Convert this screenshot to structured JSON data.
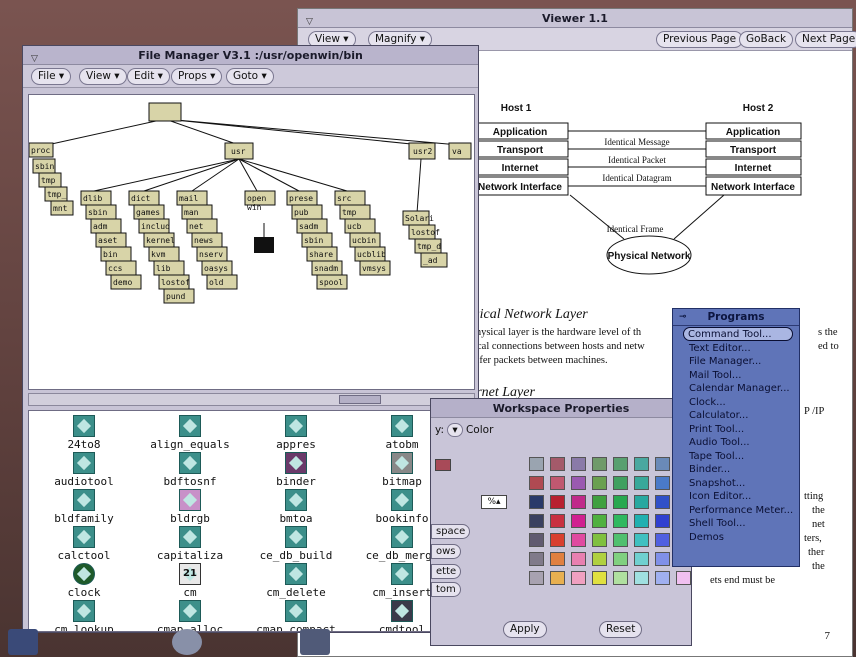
{
  "viewer": {
    "title": "Viewer 1.1",
    "menu": {
      "view": "View",
      "magnify": "Magnify"
    },
    "buttons": {
      "prev": "Previous Page",
      "back": "GoBack",
      "next": "Next Page"
    },
    "diagram": {
      "host1": "Host 1",
      "host2": "Host 2",
      "left_layers": [
        "Application",
        "Transport",
        "Internet",
        "Network Interface"
      ],
      "right_layers": [
        "Application",
        "Transport",
        "Internet",
        "Network Interface"
      ],
      "links": [
        "Identical Message",
        "Identical Packet",
        "Identical Datagram"
      ],
      "frame": "Identical Frame",
      "network": "Physical Network"
    },
    "doc": {
      "heading1": "ysical Network Layer",
      "para1_line1": "Physical layer is the hardware level of th",
      "para1_line2": "sical connections between hosts and netw",
      "para1_line3": "nsfer packets between machines.",
      "heading2": "ernet Layer",
      "frag_a": "s the",
      "frag_b": "ed to",
      "frag_c": "P /IP",
      "frag_d1": "tting",
      "frag_d2": "the",
      "frag_d3": "net",
      "frag_d4": "ters,",
      "frag_d5": "ther",
      "frag_d6": "the",
      "frag_d7": "ets end must be",
      "page": "7"
    }
  },
  "filemanager": {
    "title": "File Manager V3.1  :/usr/openwin/bin",
    "menu": [
      "File",
      "View",
      "Edit",
      "Props",
      "Goto"
    ],
    "tree": {
      "row1": [
        "proc",
        "usr",
        "usr2",
        "va"
      ],
      "proc_children": [
        "sbin",
        "tmp",
        "tmp_",
        "mnt"
      ],
      "usr_columns": [
        [
          "dlib",
          "sbin",
          "adm",
          "aset",
          "bin",
          "ccs",
          "demo"
        ],
        [
          "dict",
          "games",
          "includ",
          "kernel",
          "kvm",
          "lib",
          "lostof",
          "pund"
        ],
        [
          "mail",
          "man",
          "net",
          "news",
          "nserv",
          "oasys",
          "old"
        ],
        [
          "open",
          "win"
        ],
        [
          "prese",
          "pub",
          "sadm",
          "sbin",
          "share",
          "snadm",
          "spool"
        ],
        [
          "src",
          "tmp",
          "ucb",
          "ucbin",
          "ucblib",
          "vmsys"
        ]
      ],
      "usr2_children": [
        "Solari",
        "lostof",
        "tmp_d",
        "_ad"
      ]
    },
    "files": [
      "24to8",
      "align_equals",
      "appres",
      "atobm",
      "audiotool",
      "bdftosnf",
      "binder",
      "bitmap",
      "bldfamily",
      "bldrgb",
      "bmtoa",
      "bookinfo",
      "calctool",
      "capitaliza",
      "ce_db_build",
      "ce_db_merge",
      "clock",
      "cm",
      "cm_delete",
      "cm_insert",
      "cm_lookup",
      "cmap_alloc",
      "cmap_compact",
      "cmdtool"
    ],
    "calendar_icon_text": "21"
  },
  "workspace": {
    "title": "Workspace Properties",
    "category_label": "y:",
    "category_value": "Color",
    "side_buttons": [
      "space",
      "ows",
      "ette",
      "tom"
    ],
    "apply": "Apply",
    "reset": "Reset",
    "swatch_colors": [
      [
        "#9aa4b0",
        "#a45a6a",
        "#8a7aa8",
        "#6f9a6a",
        "#58a070",
        "#4aa8a0",
        "#6a8ab8",
        "#7ab0c8"
      ],
      [
        "#b04a52",
        "#c05870",
        "#9a5ab0",
        "#6aa050",
        "#40a060",
        "#38a89a",
        "#4a7ac8",
        "#70a0d8"
      ],
      [
        "#2a3a6a",
        "#b82030",
        "#c02a8a",
        "#40a040",
        "#28a850",
        "#28a8a0",
        "#3050c8",
        "#b86ab0"
      ],
      [
        "#3a4060",
        "#c83040",
        "#d02090",
        "#50b040",
        "#30b860",
        "#20b0b0",
        "#3040d0",
        "#c070c0"
      ],
      [
        "#605a70",
        "#d84030",
        "#e04aa0",
        "#80c040",
        "#50c070",
        "#40c0c0",
        "#5060e0",
        "#d090d0"
      ],
      [
        "#807a8a",
        "#e08040",
        "#e880b0",
        "#b0d040",
        "#80d080",
        "#70d0d0",
        "#8090e8",
        "#e0a0e0"
      ],
      [
        "#a8a2b0",
        "#e8b050",
        "#f0a0c0",
        "#e0e040",
        "#b0e0a0",
        "#a0e0e0",
        "#a0b0f0",
        "#f0c0f0"
      ]
    ]
  },
  "programs": {
    "title": "Programs",
    "items": [
      "Command Tool...",
      "Text Editor...",
      "File Manager...",
      "Mail Tool...",
      "Calendar Manager...",
      "Clock...",
      "Calculator...",
      "Print Tool...",
      "Audio Tool...",
      "Tape Tool...",
      "Binder...",
      "Snapshot...",
      "Icon Editor...",
      "Performance Meter...",
      "Shell Tool...",
      "Demos"
    ],
    "selected_index": 0
  }
}
